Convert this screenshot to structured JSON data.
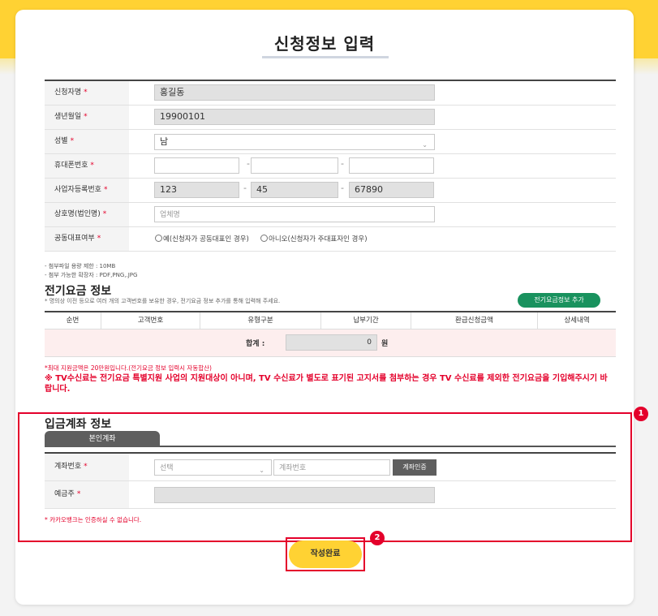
{
  "page": {
    "title": "신청정보 입력"
  },
  "applicant": {
    "name_label": "신청자명",
    "name_value": "홍길동",
    "birth_label": "생년월일",
    "birth_value": "19900101",
    "gender_label": "성별",
    "gender_value": "남",
    "phone_label": "휴대폰번호",
    "phone_part1": "",
    "phone_part2": "",
    "phone_part3": "",
    "biz_label": "사업자등록번호",
    "biz_part1": "123",
    "biz_part2": "45",
    "biz_part3": "67890",
    "company_label": "상호명(법인명)",
    "company_placeholder": "업체명",
    "corep_label": "공동대표여부",
    "corep_opt_yes": "예(신청자가 공동대표인 경우)",
    "corep_opt_no": "아니오(신청자가 주대표자인 경우)",
    "required_mark": "*",
    "separator": "-"
  },
  "attach_notes": {
    "size": "- 첨부파일 용량 제한 : 10MB",
    "types": "- 첨부 가능한 확장자 : PDF,PNG,.JPG"
  },
  "electric": {
    "title": "전기요금 정보",
    "desc": "* 명의상 이전 등으로 여러 개의 고객번호를 보유한 경우, 전기요금 정보 추가를 통해 입력해 주세요.",
    "add_button": "전기요금정보 추가",
    "columns": [
      "순번",
      "고객번호",
      "유형구분",
      "납부기간",
      "환급신청금액",
      "상세내역"
    ],
    "total_label": "합계 :",
    "total_value": "0",
    "total_unit": "원",
    "notice_small": "*최대 지원금액은 20만원입니다.(전기요금 정보 입력시 자동합산)",
    "notice_big": "※ TV수신료는 전기요금 특별지원 사업의 지원대상이 아니며, TV 수신료가 별도로 표기된 고지서를 첨부하는 경우 TV 수신료를 제외한 전기요금을 기입해주시기 바랍니다."
  },
  "deposit": {
    "title": "입금계좌 정보",
    "tab_label": "본인계좌",
    "account_label": "계좌번호",
    "bank_select": "선택",
    "account_placeholder": "계좌번호",
    "verify_button": "계좌인증",
    "holder_label": "예금주",
    "holder_value": "",
    "note": "* 카카오뱅크는 인증하실 수 없습니다."
  },
  "markers": {
    "one": "1",
    "two": "2"
  },
  "submit": {
    "label": "작성완료"
  },
  "colors": {
    "brand_yellow": "#ffd233",
    "accent_red": "#e4002b",
    "green": "#19925e"
  },
  "icons": {
    "dropdown": "chevron-down-icon",
    "radio": "radio-icon"
  }
}
